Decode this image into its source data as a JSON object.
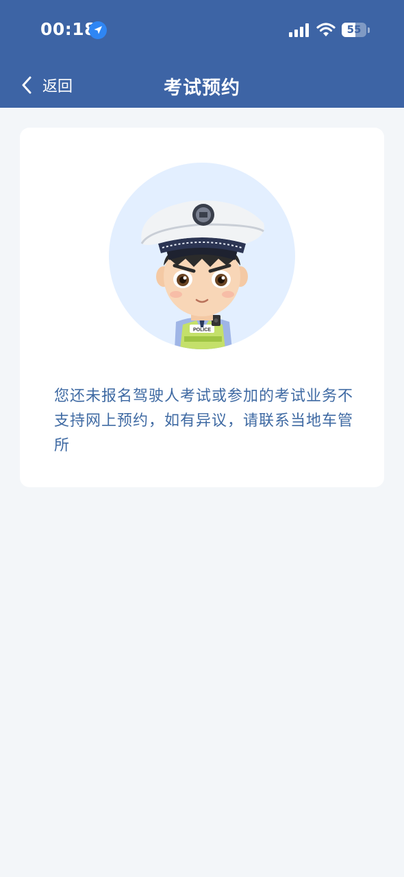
{
  "status_bar": {
    "time": "00:18",
    "battery_level": "55",
    "battery_fraction": 0.55,
    "icons": [
      "location-arrow-icon",
      "cellular-signal-icon",
      "wifi-icon",
      "battery-icon"
    ]
  },
  "nav": {
    "back_label": "返回",
    "title": "考试预约"
  },
  "content": {
    "message": "您还未报名驾驶人考试或参加的考试业务不支持网上预约，如有异议，请联系当地车管所",
    "badge_text": "POLICE"
  },
  "colors": {
    "header_bg": "#3d64a5",
    "page_bg": "#f3f6f9",
    "message_text": "#3f6aa3",
    "avatar_circle": "#e3efff"
  }
}
